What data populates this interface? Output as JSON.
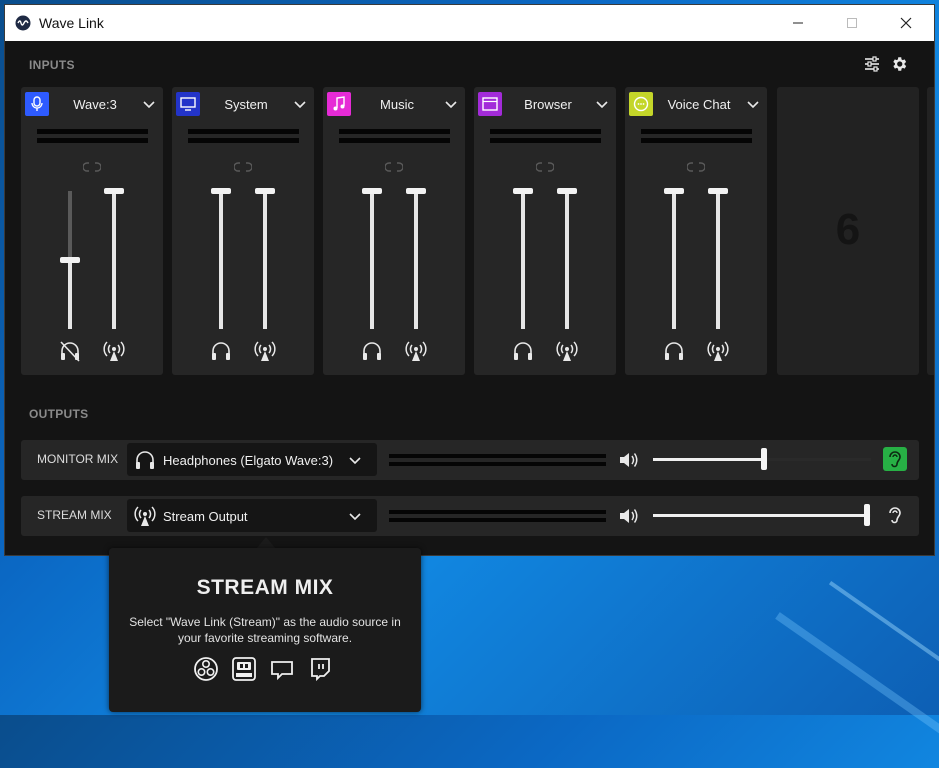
{
  "window": {
    "title": "Wave Link"
  },
  "colors": {
    "mic": "#2e5bff",
    "system": "#2334c9",
    "music": "#e62bd6",
    "browser": "#a32bd9",
    "voice": "#c4d629",
    "monitor_ear": "#27b045"
  },
  "inputs": {
    "section_label": "INPUTS",
    "toolbar_icons": [
      "mixer-settings-icon",
      "gear-icon"
    ],
    "channels": [
      {
        "name": "Wave:3",
        "icon": "microphone-icon",
        "monitor_level": 0.5,
        "stream_level": 1.0,
        "monitor_muted": true
      },
      {
        "name": "System",
        "icon": "monitor-icon",
        "monitor_level": 1.0,
        "stream_level": 1.0,
        "monitor_muted": false
      },
      {
        "name": "Music",
        "icon": "music-note-icon",
        "monitor_level": 1.0,
        "stream_level": 1.0,
        "monitor_muted": false
      },
      {
        "name": "Browser",
        "icon": "browser-window-icon",
        "monitor_level": 1.0,
        "stream_level": 1.0,
        "monitor_muted": false
      },
      {
        "name": "Voice Chat",
        "icon": "chat-bubble-icon",
        "monitor_level": 1.0,
        "stream_level": 1.0,
        "monitor_muted": false
      }
    ],
    "empty_slot_label": "6"
  },
  "outputs": {
    "section_label": "OUTPUTS",
    "monitor": {
      "label": "MONITOR MIX",
      "device": "Headphones (Elgato Wave:3)",
      "level": 0.51,
      "listening": true
    },
    "stream": {
      "label": "STREAM MIX",
      "device": "Stream Output",
      "level": 0.98,
      "listening": false
    }
  },
  "tooltip": {
    "title": "STREAM MIX",
    "body": "Select \"Wave Link (Stream)\" as the audio source in your favorite streaming software.",
    "icons": [
      "obs-icon",
      "streamlabs-obs-icon",
      "streamlabs-icon",
      "twitch-icon"
    ]
  }
}
